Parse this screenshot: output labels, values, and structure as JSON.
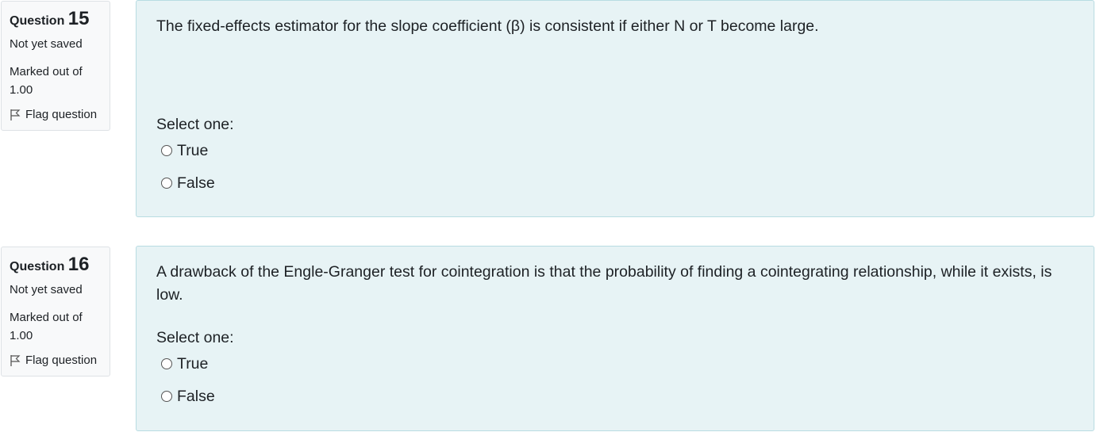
{
  "questions": [
    {
      "label": "Question",
      "number": "15",
      "state": "Not yet saved",
      "grade": "Marked out of 1.00",
      "flag_label": "Flag question",
      "text": "The fixed-effects estimator for the slope coefficient (β) is consistent if either N or T become large.",
      "prompt": "Select one:",
      "options": [
        "True",
        "False"
      ]
    },
    {
      "label": "Question",
      "number": "16",
      "state": "Not yet saved",
      "grade": "Marked out of 1.00",
      "flag_label": "Flag question",
      "text": "A drawback of the Engle-Granger test for cointegration is that the probability of finding a cointegrating relationship, while it exists, is low.",
      "prompt": "Select one:",
      "options": [
        "True",
        "False"
      ]
    }
  ],
  "colors": {
    "content_bg": "#e7f3f5",
    "content_border": "#b8dce2",
    "info_bg": "#f8f9fa"
  },
  "icons": {
    "flag": "flag-outline-icon"
  }
}
